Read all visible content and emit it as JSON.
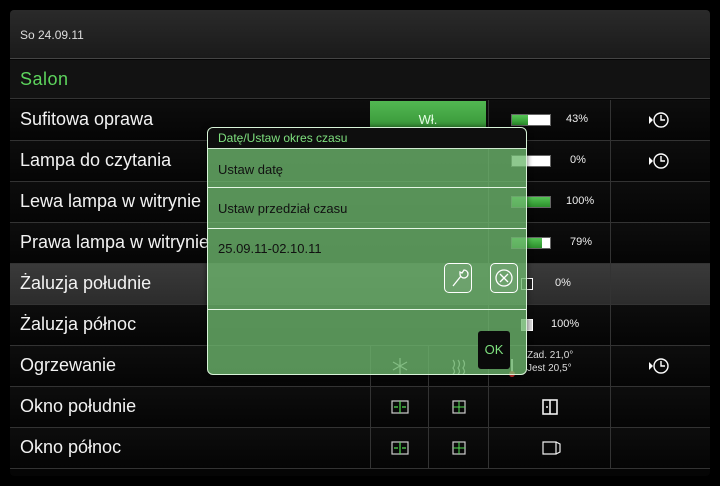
{
  "header": {
    "date": "So 24.09.11"
  },
  "room": {
    "title": "Salon"
  },
  "rows": [
    {
      "label": "Sufitowa oprawa",
      "button": "Wł.",
      "level_pct": 43,
      "level_text": "43%",
      "icon": "clock-icon"
    },
    {
      "label": "Lampa do czytania",
      "level_pct": 0,
      "level_text": "0%",
      "icon": "clock-icon"
    },
    {
      "label": "Lewa lampa w witrynie",
      "level_pct": 100,
      "level_text": "100%"
    },
    {
      "label": "Prawa lampa w witrynie",
      "level_pct": 79,
      "level_text": "79%"
    },
    {
      "label": "Żaluzja południe",
      "level_pct": 0,
      "level_text": "0%"
    },
    {
      "label": "Żaluzja północ",
      "level_pct": 100,
      "level_text": "100%"
    },
    {
      "label": "Ogrzewanie",
      "setpoint": "Zad. 21,0°",
      "actual": "Jest 20,5°",
      "icon": "clock-icon"
    },
    {
      "label": "Okno południe"
    },
    {
      "label": "Okno północ"
    }
  ],
  "modal": {
    "title": "Datę/Ustaw okres czasu",
    "items": [
      "Ustaw datę",
      "Ustaw przedział czasu"
    ],
    "range": "25.09.11-02.10.11",
    "ok_label": "OK"
  },
  "colors": {
    "accent": "#5dd45d",
    "bar_fill": "#3aa83a",
    "modal_bg": "#6eb96e"
  }
}
